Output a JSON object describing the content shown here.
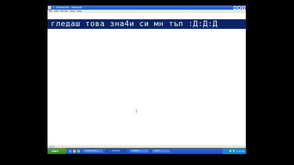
{
  "window": {
    "title": "1 - Бележник - Notepad"
  },
  "menubar": {
    "items": [
      "File",
      "Edit",
      "Format",
      "View",
      "Help"
    ]
  },
  "document": {
    "text": "гледаш това зна4и си мн тъп :Д:Д:Д"
  },
  "taskbar": {
    "start_label": "start",
    "tasks": [
      "4 Internet Ex...",
      "1 - Notepad",
      "Untitled",
      "Paint"
    ],
    "clock": "5:32 PM"
  },
  "colors": {
    "selection": "#0a246a",
    "titlebar": "#0a4fd0",
    "taskbar": "#1d50c0",
    "start": "#2f8a23"
  },
  "icons": [
    "window-app-icon",
    "minimize-icon",
    "maximize-icon",
    "close-icon",
    "ibeam-cursor-icon",
    "start-logo-icon"
  ]
}
